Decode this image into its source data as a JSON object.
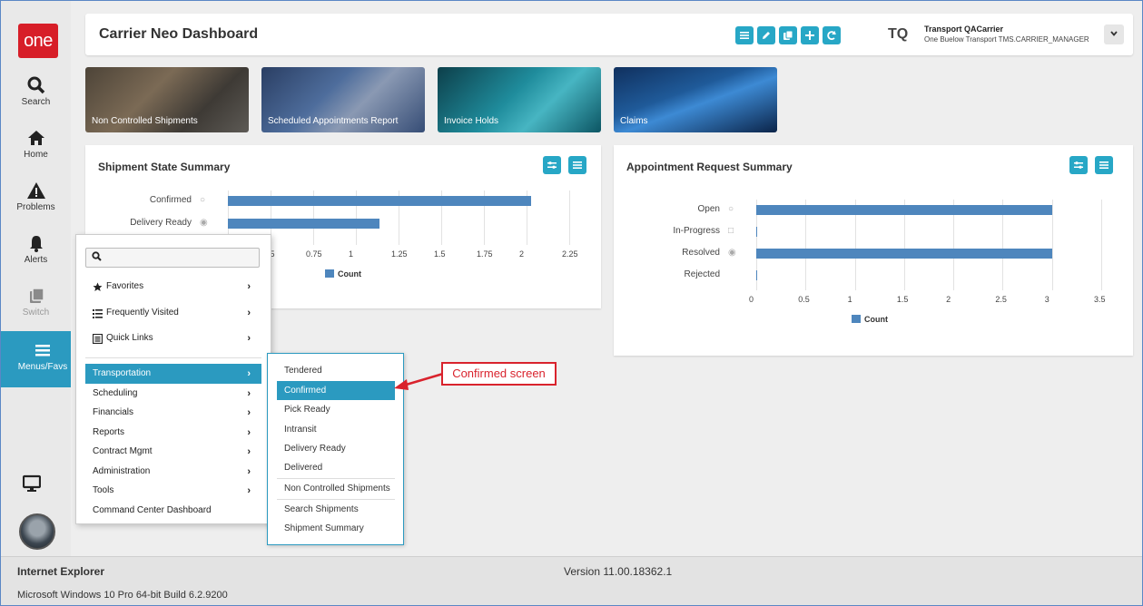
{
  "nav": {
    "logo": "one",
    "items": [
      {
        "label": "Search",
        "icon": "search-icon"
      },
      {
        "label": "Home",
        "icon": "home-icon"
      },
      {
        "label": "Problems",
        "icon": "warning-icon"
      },
      {
        "label": "Alerts",
        "icon": "bell-icon"
      },
      {
        "label": "Switch",
        "icon": "switch-icon"
      },
      {
        "label": "Menus/Favs",
        "icon": "menu-icon"
      }
    ]
  },
  "header": {
    "title": "Carrier Neo Dashboard",
    "user_initials": "TQ",
    "user_name": "Transport QACarrier",
    "user_role": "One Buelow Transport TMS.CARRIER_MANAGER"
  },
  "tiles": [
    {
      "label": "Non Controlled Shipments"
    },
    {
      "label": "Scheduled Appointments Report"
    },
    {
      "label": "Invoice Holds"
    },
    {
      "label": "Claims"
    }
  ],
  "panels": {
    "shipment": {
      "title": "Shipment State Summary"
    },
    "appointment": {
      "title": "Appointment Request Summary"
    }
  },
  "chart_data": [
    {
      "type": "bar",
      "title": "Shipment State Summary",
      "categories": [
        "Confirmed",
        "Delivery Ready"
      ],
      "values": [
        2,
        1
      ],
      "series": [
        {
          "name": "Count",
          "values": [
            2,
            1
          ]
        }
      ],
      "xticks": [
        "5",
        "0.5",
        "0.75",
        "1",
        "1.25",
        "1.5",
        "1.75",
        "2",
        "2.25"
      ],
      "xlim": [
        0,
        2.25
      ],
      "legend": "bottom"
    },
    {
      "type": "bar",
      "title": "Appointment Request Summary",
      "categories": [
        "Open",
        "In-Progress",
        "Resolved",
        "Rejected"
      ],
      "values": [
        3,
        0,
        3,
        0
      ],
      "series": [
        {
          "name": "Count",
          "values": [
            3,
            0,
            3,
            0
          ]
        }
      ],
      "xticks": [
        "0",
        "0.5",
        "1",
        "1.5",
        "2",
        "2.5",
        "3",
        "3.5"
      ],
      "xlim": [
        0,
        3.5
      ],
      "legend": "bottom"
    }
  ],
  "menu": {
    "search_placeholder": "",
    "favorites": "Favorites",
    "frequently_visited": "Frequently Visited",
    "quick_links": "Quick Links",
    "items": [
      "Transportation",
      "Scheduling",
      "Financials",
      "Reports",
      "Contract Mgmt",
      "Administration",
      "Tools",
      "Command Center Dashboard"
    ]
  },
  "submenu": {
    "items": [
      "Tendered",
      "Confirmed",
      "Pick Ready",
      "Intransit",
      "Delivery Ready",
      "Delivered",
      "Non Controlled Shipments",
      "Search Shipments",
      "Shipment Summary"
    ]
  },
  "callout": "Confirmed screen",
  "statusbar": {
    "browser": "Internet Explorer",
    "version": "Version 11.00.18362.1",
    "os": "Microsoft Windows 10 Pro 64-bit Build 6.2.9200"
  },
  "colors": {
    "accent": "#2b9ac0",
    "bar": "#4e86bd",
    "logo": "#d71e28",
    "callout": "#d9232d"
  }
}
